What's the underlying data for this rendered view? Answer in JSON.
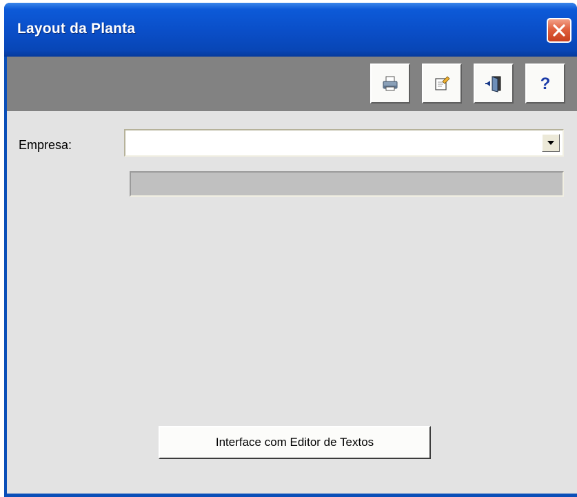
{
  "window": {
    "title": "Layout da Planta",
    "colors": {
      "titlebar": "#0a4fc9",
      "client": "#e3e3e3",
      "toolbar": "#828282",
      "close": "#e0603e"
    }
  },
  "toolbar": {
    "buttons": [
      {
        "name": "print",
        "icon": "printer-icon"
      },
      {
        "name": "edit",
        "icon": "notepad-icon"
      },
      {
        "name": "exit",
        "icon": "door-exit-icon"
      },
      {
        "name": "help",
        "icon": "question-icon",
        "glyph": "?"
      }
    ]
  },
  "form": {
    "empresa_label": "Empresa:",
    "empresa_value": "",
    "empresa_description": ""
  },
  "actions": {
    "editor_button_label": "Interface com Editor de Textos"
  }
}
